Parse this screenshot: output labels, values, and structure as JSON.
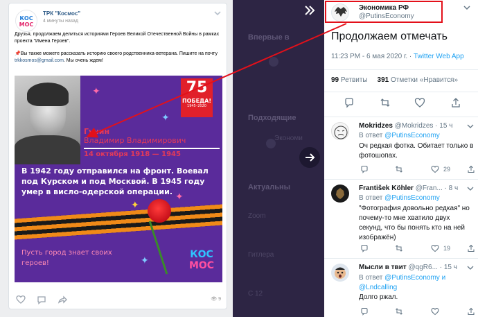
{
  "vk": {
    "logo_line1": "КОС",
    "logo_line2": "МОС",
    "author": "ТРК \"Космос\"",
    "time": "4 минуты назад",
    "text_p1": "Друзья, продолжаем делиться историями Героев Великой Отечественной Войны в рамках проекта \"Имена Героев\".",
    "text_p2_pin": "📌",
    "text_p2": "Вы также можете рассказать историю своего родственника-ветерана. Пишите на почту ",
    "text_p2_email": "trkkosmos@gmail.com",
    "text_p2_end": ". Мы очень ждем!",
    "poster": {
      "surname": "Гунин",
      "name": "Владимир Владимирович",
      "dates": "14 октября 1918 — 1945",
      "badge_number": "75",
      "badge_word": "ПОБЕДА!",
      "badge_years": "1945–2020",
      "body": "В 1942 году отправился на фронт. Воевал под Курском и под Москвой. В 1945 году умер в висло-одерской операции.",
      "slogan": "Пусть город знает своих героев!",
      "logo_top": "КОС",
      "logo_bottom": "МОС"
    },
    "views": "9"
  },
  "background": {
    "items": [
      {
        "title": "Впервые в",
        "sub": ""
      },
      {
        "title": "Подходящие",
        "sub": "Экономи"
      },
      {
        "title": "Актуальны",
        "sub": "Zoom"
      },
      {
        "title": "",
        "sub": "Гитлера"
      },
      {
        "title": "",
        "sub": "С 12"
      }
    ]
  },
  "tweet": {
    "name": "Экономика РФ",
    "handle": "@PutinsEconomy",
    "text": "Продолжаем отмечать",
    "time": "11:23 PM - 6 мая 2020 г.",
    "source": "Twitter Web App",
    "retweets_count": "99",
    "retweets_label": "Ретвиты",
    "likes_count": "391",
    "likes_label": "Отметки «Нравится»"
  },
  "replies": [
    {
      "name": "Mokridzes",
      "handle": "@Mokridzes",
      "age": "15 ч",
      "reply_to_label": "В ответ",
      "reply_to": "@PutinsEconomy",
      "text": "Оч редкая фотка. Обитает только в фотошопах.",
      "likes": "29"
    },
    {
      "name": "František Köhler",
      "handle": "@Fran...",
      "age": "8 ч",
      "reply_to_label": "В ответ",
      "reply_to": "@PutinsEconomy",
      "text": "\"Фотография довольно редкая\" но почему-то мне хватило двух секунд, что бы понять кто на ней изображён)",
      "likes": "19"
    },
    {
      "name": "Мысли в твит",
      "handle": "@qgR6...",
      "age": "15 ч",
      "reply_to_label": "В ответ",
      "reply_to": "@PutinsEconomy и @Lndcalling",
      "text": "Долго ржал.",
      "likes": ""
    }
  ],
  "colors": {
    "highlight": "#e3101a",
    "twitter_blue": "#1da1f2",
    "poster_purple": "#5a2b9b",
    "vk_link": "#2a5885"
  }
}
